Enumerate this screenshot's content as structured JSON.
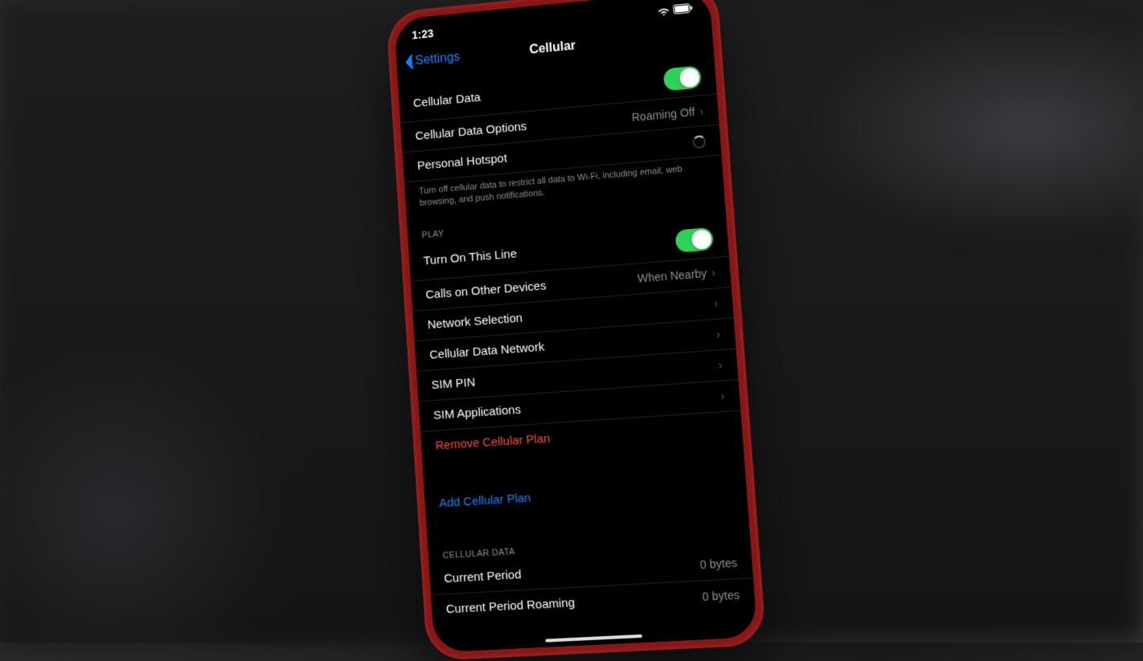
{
  "status": {
    "time": "1:23"
  },
  "nav": {
    "back": "Settings",
    "title": "Cellular"
  },
  "section1": {
    "cellular_data": "Cellular Data",
    "cellular_data_options": "Cellular Data Options",
    "cellular_data_options_value": "Roaming Off",
    "personal_hotspot": "Personal Hotspot",
    "footer": "Turn off cellular data to restrict all data to Wi-Fi, including email, web browsing, and push notifications."
  },
  "section2": {
    "header": "PLAY",
    "turn_on_line": "Turn On This Line",
    "calls_other": "Calls on Other Devices",
    "calls_other_value": "When Nearby",
    "network_selection": "Network Selection",
    "cellular_data_network": "Cellular Data Network",
    "sim_pin": "SIM PIN",
    "sim_apps": "SIM Applications",
    "remove_plan": "Remove Cellular Plan"
  },
  "section3": {
    "add_plan": "Add Cellular Plan"
  },
  "section4": {
    "header": "CELLULAR DATA",
    "current_period": "Current Period",
    "current_period_value": "0 bytes",
    "current_period_roaming": "Current Period Roaming",
    "current_period_roaming_value": "0 bytes"
  }
}
